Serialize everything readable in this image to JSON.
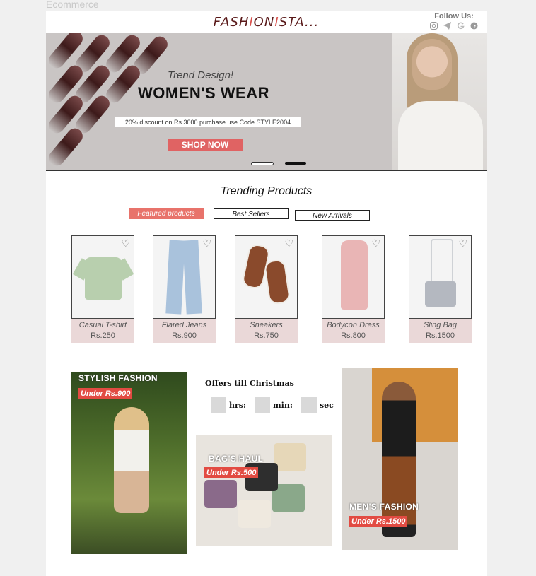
{
  "canvas_label": "Ecommerce",
  "header": {
    "logo_part1": "FASH",
    "logo_accent": "I",
    "logo_part2": "ON",
    "logo_accent2": "I",
    "logo_part3": "STA...",
    "follow_label": "Follow Us:",
    "social_icons": [
      "instagram-icon",
      "telegram-icon",
      "google-icon",
      "facebook-icon"
    ]
  },
  "hero": {
    "subtitle": "Trend Design!",
    "title": "WOMEN'S WEAR",
    "promo": "20% discount on Rs.3000 purchase use Code STYLE2004",
    "button": "SHOP NOW"
  },
  "trending": {
    "title": "Trending Products",
    "tabs": [
      "Featured products",
      "Best Sellers",
      "New Arrivals"
    ],
    "products": [
      {
        "name": "Casual T-shirt",
        "price": "Rs.250"
      },
      {
        "name": "Flared Jeans",
        "price": "Rs.900"
      },
      {
        "name": "Sneakers",
        "price": "Rs.750"
      },
      {
        "name": "Bodycon Dress",
        "price": "Rs.800"
      },
      {
        "name": "Sling Bag",
        "price": "Rs.1500"
      }
    ]
  },
  "promos": {
    "stylish": {
      "title": "STYLISH FASHION",
      "tag": "Under Rs.900"
    },
    "bags": {
      "title": "BAG'S HAUL",
      "tag": "Under Rs.500"
    },
    "mens": {
      "title": "MEN'S FASHION",
      "tag": "Under Rs.1500"
    }
  },
  "offers": {
    "title": "Offers till Christmas",
    "hrs": "hrs:",
    "min": "min:",
    "sec": "sec"
  },
  "colors": {
    "accent": "#e06363",
    "brand": "#5a1a1a",
    "tag": "#e24b42"
  }
}
